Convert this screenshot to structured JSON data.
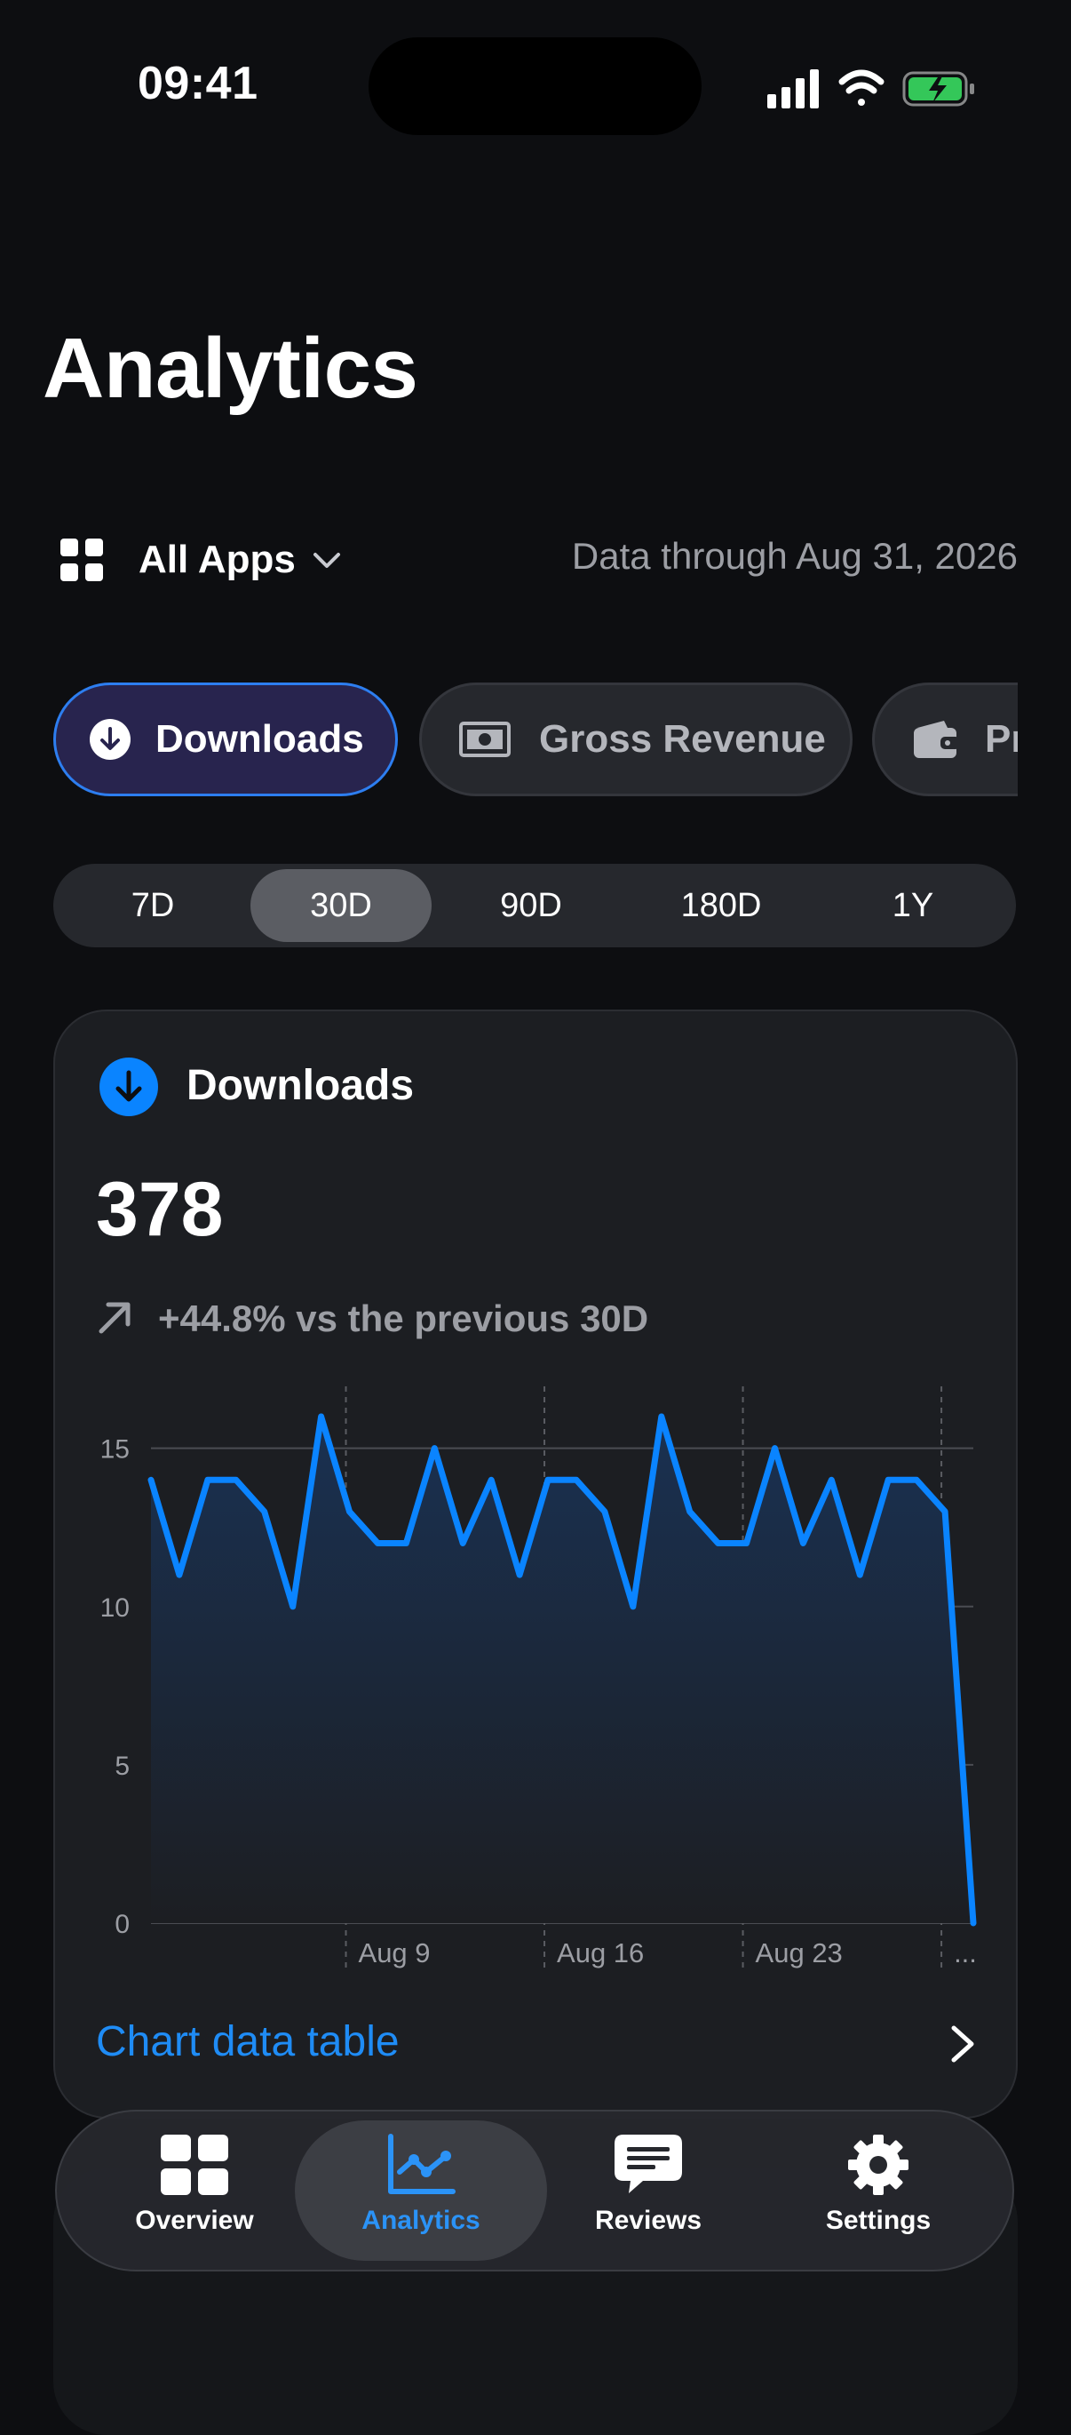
{
  "status_bar": {
    "time": "09:41"
  },
  "page": {
    "title": "Analytics"
  },
  "filter": {
    "app_label": "All Apps",
    "data_through": "Data through Aug 31, 2026"
  },
  "metric_chips": [
    {
      "label": "Downloads",
      "icon": "download-icon",
      "selected": true
    },
    {
      "label": "Gross Revenue",
      "icon": "banknote-icon",
      "selected": false
    },
    {
      "label": "Pr",
      "icon": "wallet-icon",
      "selected": false
    }
  ],
  "ranges": [
    {
      "label": "7D",
      "selected": false
    },
    {
      "label": "30D",
      "selected": true
    },
    {
      "label": "90D",
      "selected": false
    },
    {
      "label": "180D",
      "selected": false
    },
    {
      "label": "1Y",
      "selected": false
    }
  ],
  "card": {
    "title": "Downloads",
    "value": "378",
    "trend": "+44.8% vs the previous 30D",
    "table_link": "Chart data table"
  },
  "chart_data": {
    "type": "area",
    "title": "",
    "xlabel": "",
    "ylabel": "",
    "x": [
      "Aug 2",
      "Aug 3",
      "Aug 4",
      "Aug 5",
      "Aug 6",
      "Aug 7",
      "Aug 8",
      "Aug 9",
      "Aug 10",
      "Aug 11",
      "Aug 12",
      "Aug 13",
      "Aug 14",
      "Aug 15",
      "Aug 16",
      "Aug 17",
      "Aug 18",
      "Aug 19",
      "Aug 20",
      "Aug 21",
      "Aug 22",
      "Aug 23",
      "Aug 24",
      "Aug 25",
      "Aug 26",
      "Aug 27",
      "Aug 28",
      "Aug 29",
      "Aug 30",
      "Aug 31"
    ],
    "values": [
      14,
      11,
      14,
      14,
      13,
      10,
      16,
      13,
      12,
      12,
      15,
      12,
      14,
      11,
      14,
      14,
      13,
      10,
      16,
      13,
      12,
      12,
      15,
      12,
      14,
      11,
      14,
      14,
      13,
      0
    ],
    "ylim": [
      0,
      16
    ],
    "yticks": [
      "0",
      "5",
      "10",
      "15"
    ],
    "xticks": [
      "Aug 9",
      "Aug 16",
      "Aug 23",
      "..."
    ],
    "grid": true,
    "colors": {
      "line": "#0a84ff",
      "fill_top": "#1a3152",
      "fill_bottom": "#1c1e22"
    }
  },
  "tabs": [
    {
      "label": "Overview",
      "icon": "grid-icon",
      "active": false
    },
    {
      "label": "Analytics",
      "icon": "chart-icon",
      "active": true
    },
    {
      "label": "Reviews",
      "icon": "message-icon",
      "active": false
    },
    {
      "label": "Settings",
      "icon": "gear-icon",
      "active": false
    }
  ],
  "colors": {
    "accent": "#0a84ff",
    "background": "#0d0e11",
    "card": "#1c1e22"
  }
}
